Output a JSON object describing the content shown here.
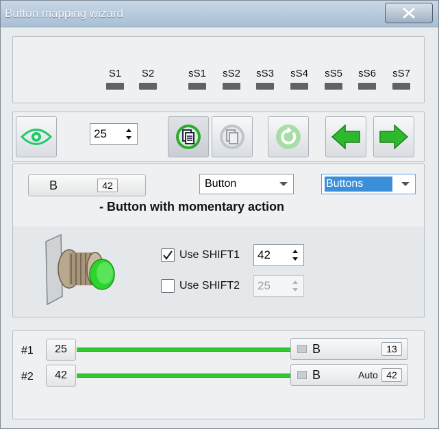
{
  "window": {
    "title": "Button mapping wizard"
  },
  "indicators": [
    "S1",
    "S2",
    "sS1",
    "sS2",
    "sS3",
    "sS4",
    "sS5",
    "sS6",
    "sS7"
  ],
  "toolbar": {
    "spin_value": "25"
  },
  "mapping": {
    "key_label": "B",
    "key_code": "42",
    "type_select": "Button",
    "group_select": "Buttons",
    "description": "- Button with momentary action"
  },
  "shift": {
    "shift1_label": "Use SHIFT1",
    "shift1_value": "42",
    "shift1_checked": true,
    "shift2_label": "Use SHIFT2",
    "shift2_value": "25",
    "shift2_checked": false
  },
  "routes": [
    {
      "label": "#1",
      "input": "25",
      "key": "B",
      "mode": "",
      "code": "13"
    },
    {
      "label": "#2",
      "input": "42",
      "key": "B",
      "mode": "Auto",
      "code": "42"
    }
  ],
  "colors": {
    "accent_green": "#2ecb31",
    "selection_blue": "#3b8fd9"
  }
}
